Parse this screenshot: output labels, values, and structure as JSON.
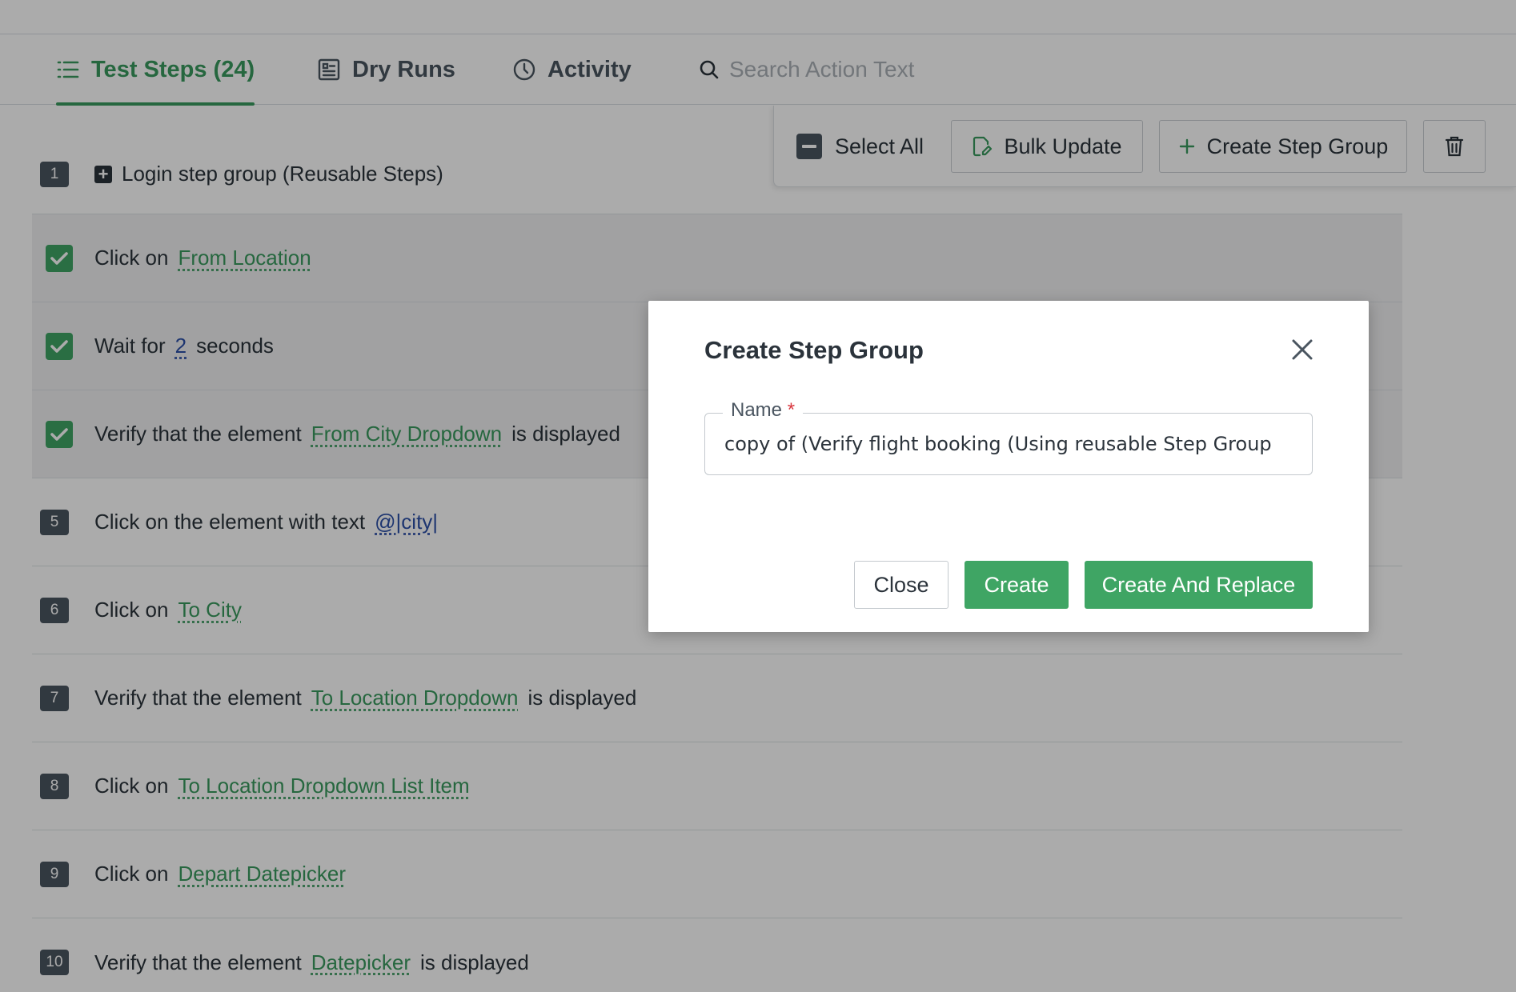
{
  "tabs": [
    {
      "label": "Test Steps (24)",
      "icon": "list-icon"
    },
    {
      "label": "Dry Runs",
      "icon": "dry-runs-icon"
    },
    {
      "label": "Activity",
      "icon": "clock-icon"
    }
  ],
  "search": {
    "placeholder": "Search Action Text"
  },
  "bulk_bar": {
    "select_all": "Select All",
    "bulk_update": "Bulk Update",
    "create_step_group": "Create Step Group"
  },
  "steps": [
    {
      "num": "1",
      "text": "Login step group (Reusable Steps)"
    },
    {
      "pre": "Click on",
      "link": "From Location"
    },
    {
      "pre": "Wait for",
      "value": "2",
      "post": "seconds"
    },
    {
      "pre": "Verify that the element",
      "link": "From City Dropdown",
      "post": "is displayed"
    },
    {
      "num": "5",
      "pre": "Click on the element with text",
      "value": "@|city|"
    },
    {
      "num": "6",
      "pre": "Click on",
      "link": "To City"
    },
    {
      "num": "7",
      "pre": "Verify that the element",
      "link": "To Location Dropdown",
      "post": "is displayed"
    },
    {
      "num": "8",
      "pre": "Click on",
      "link": "To Location Dropdown List Item"
    },
    {
      "num": "9",
      "pre": "Click on",
      "link": "Depart Datepicker"
    },
    {
      "num": "10",
      "pre": "Verify that the element",
      "link": "Datepicker",
      "post": "is displayed"
    }
  ],
  "modal": {
    "title": "Create Step Group",
    "name_label": "Name",
    "required_mark": "*",
    "name_value": "copy of (Verify flight booking (Using reusable Step Group",
    "close_label": "Close",
    "create_label": "Create",
    "create_replace_label": "Create And Replace"
  },
  "colors": {
    "accent": "#3a9a5e",
    "button_green": "#3fa564",
    "link_blue": "#2c4fa8"
  }
}
